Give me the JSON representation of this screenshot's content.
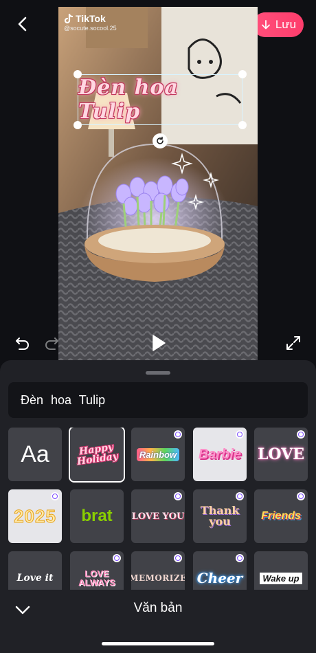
{
  "header": {
    "save_label": "Lưu",
    "back_icon": "chevron-left-icon",
    "save_icon": "arrow-down-icon",
    "accent": "#fe3d6c"
  },
  "preview": {
    "watermark_brand": "TikTok",
    "watermark_handle": "@socute.socool.25",
    "overlay_text": "Đèn hoa Tulip"
  },
  "playback": {
    "undo_icon": "undo-icon",
    "redo_icon": "redo-icon",
    "play_icon": "play-icon",
    "fullscreen_icon": "fullscreen-icon"
  },
  "editor": {
    "text_value": "Đèn hoa Tulip",
    "styles": [
      {
        "id": "default",
        "label": "Aa"
      },
      {
        "id": "happy",
        "label": "Happy Holiday",
        "selected": true
      },
      {
        "id": "rainbow",
        "label": "Rainbow",
        "premium": true
      },
      {
        "id": "barbie",
        "label": "Barbie",
        "premium": true
      },
      {
        "id": "love",
        "label": "LOVE",
        "premium": true
      },
      {
        "id": "y2025",
        "label": "2025",
        "premium": true
      },
      {
        "id": "brat",
        "label": "brat"
      },
      {
        "id": "loveyou",
        "label": "LOVE YOU",
        "premium": true
      },
      {
        "id": "thank",
        "label": "Thank you",
        "premium": true
      },
      {
        "id": "friends",
        "label": "Friends",
        "premium": true
      },
      {
        "id": "loveit",
        "label": "Love it"
      },
      {
        "id": "lovealways",
        "label": "LOVE ALWAYS",
        "premium": true
      },
      {
        "id": "memorize",
        "label": "MEMORIZE",
        "premium": true
      },
      {
        "id": "cheer",
        "label": "Cheer",
        "premium": true
      },
      {
        "id": "wakeup",
        "label": "Wake up"
      }
    ],
    "footer_title": "Văn bản"
  }
}
